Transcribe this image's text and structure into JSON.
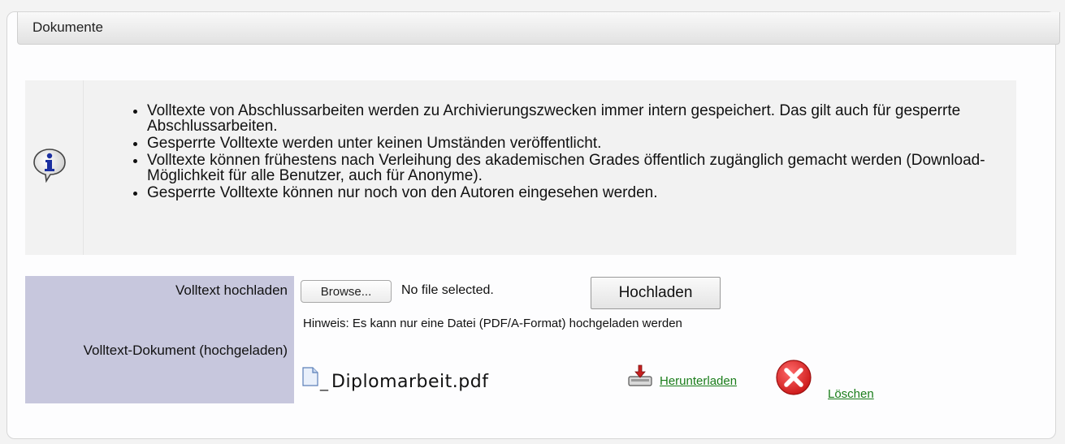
{
  "panel": {
    "title": "Dokumente"
  },
  "info": {
    "icon": "info-speech-bubble-icon",
    "items": [
      "Volltexte von Abschlussarbeiten werden zu Archivierungszwecken immer intern gespeichert. Das gilt auch für gesperrte Abschlussarbeiten.",
      "Gesperrte Volltexte werden unter keinen Umständen veröffentlicht.",
      "Volltexte können frühestens nach Verleihung des akademischen Grades öffentlich zugänglich gemacht werden (Download-Möglichkeit für alle Benutzer, auch für Anonyme).",
      "Gesperrte Volltexte können nur noch von den Autoren eingesehen werden."
    ]
  },
  "form": {
    "upload_label": "Volltext hochladen",
    "uploaded_label": "Volltext-Dokument (hochgeladen)",
    "browse_label": "Browse...",
    "file_status": "No file selected.",
    "upload_button": "Hochladen",
    "hint": "Hinweis: Es kann nur eine Datei (PDF/A-Format) hochgeladen werden"
  },
  "document": {
    "icon": "document-icon",
    "filename": "Diplomarbeit.pdf",
    "download_icon": "download-icon",
    "download_label": "Herunterladen",
    "delete_icon": "delete-icon",
    "delete_label": "Löschen"
  },
  "colors": {
    "label_column": "#c7c7dd",
    "link": "#1a7d1a",
    "delete_red": "#d92020"
  }
}
